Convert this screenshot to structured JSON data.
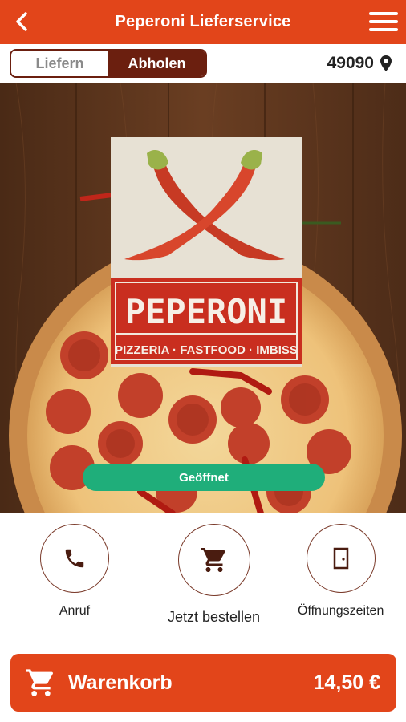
{
  "header": {
    "title": "Peperoni Lieferservice",
    "back_icon": "chevron-left-icon",
    "menu_icon": "hamburger-menu-icon",
    "color": "#e2451a"
  },
  "mode": {
    "options": [
      "Liefern",
      "Abholen"
    ],
    "selected": "Abholen",
    "zip": "49090",
    "zip_icon": "location-pin-icon"
  },
  "brand": {
    "name": "PEPERONI",
    "tagline": "PIZZERIA · FASTFOOD · IMBISS",
    "status": "Geöffnet",
    "status_color": "#1fae7a"
  },
  "actions": [
    {
      "label": "Anruf",
      "icon": "phone-icon"
    },
    {
      "label": "Jetzt bestellen",
      "icon": "shopping-cart-icon"
    },
    {
      "label": "Öffnungszeiten",
      "icon": "door-icon"
    }
  ],
  "cart": {
    "label": "Warenkorb",
    "total": "14,50 €",
    "icon": "shopping-cart-icon"
  }
}
